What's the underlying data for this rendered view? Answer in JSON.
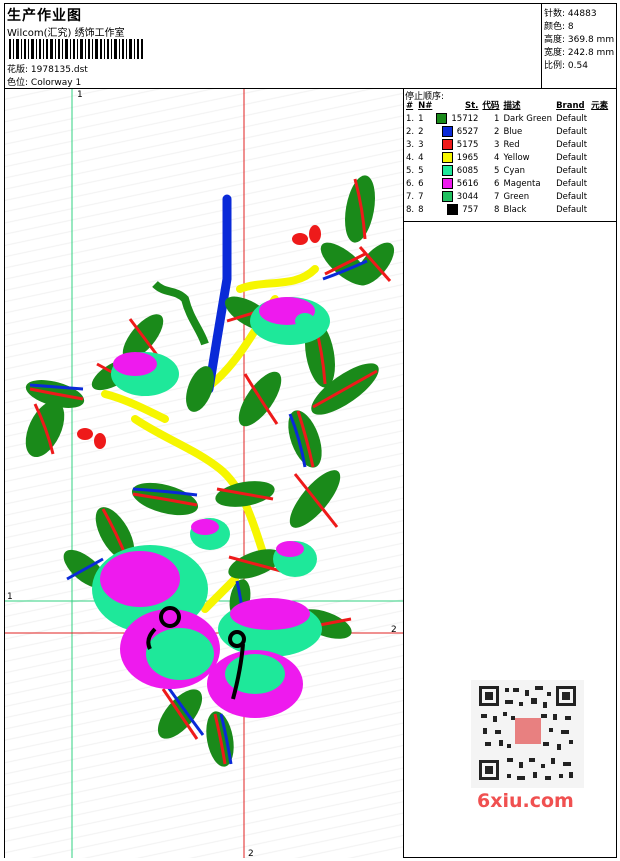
{
  "header": {
    "title": "生产作业图",
    "company": "Wilcom(汇究) 绣饰工作室",
    "pattern_label": "花版:",
    "pattern_value": "1978135.dst",
    "colorway_label": "色位:",
    "colorway_value": "Colorway 1"
  },
  "stats": {
    "stitches_label": "针数:",
    "stitches_value": "44883",
    "colors_label": "颜色:",
    "colors_value": "8",
    "height_label": "高度:",
    "height_value": "369.8 mm",
    "width_label": "宽度:",
    "width_value": "242.8 mm",
    "scale_label": "比例:",
    "scale_value": "0.54"
  },
  "stop_sequence": {
    "title": "停止顺序:",
    "columns": [
      "#",
      "N#",
      "St.",
      "代码",
      "描述",
      "Brand",
      "元素"
    ],
    "rows": [
      {
        "idx": "1.",
        "n": "1",
        "color": "#1a8a1a",
        "st": "15712",
        "code": "1",
        "desc": "Dark Green",
        "brand": "Default"
      },
      {
        "idx": "2.",
        "n": "2",
        "color": "#0a2ad8",
        "st": "6527",
        "code": "2",
        "desc": "Blue",
        "brand": "Default"
      },
      {
        "idx": "3.",
        "n": "3",
        "color": "#ee1a1a",
        "st": "5175",
        "code": "3",
        "desc": "Red",
        "brand": "Default"
      },
      {
        "idx": "4.",
        "n": "4",
        "color": "#f6f600",
        "st": "1965",
        "code": "4",
        "desc": "Yellow",
        "brand": "Default"
      },
      {
        "idx": "5.",
        "n": "5",
        "color": "#1ee89a",
        "st": "6085",
        "code": "5",
        "desc": "Cyan",
        "brand": "Default"
      },
      {
        "idx": "6.",
        "n": "6",
        "color": "#ee1aee",
        "st": "5616",
        "code": "6",
        "desc": "Magenta",
        "brand": "Default"
      },
      {
        "idx": "7.",
        "n": "7",
        "color": "#20c060",
        "st": "3044",
        "code": "7",
        "desc": "Green",
        "brand": "Default"
      },
      {
        "idx": "8.",
        "n": "8",
        "color": "#000000",
        "st": "757",
        "code": "8",
        "desc": "Black",
        "brand": "Default"
      }
    ]
  },
  "guides": {
    "top_marker": "1",
    "left_marker": "1",
    "right_marker": "2",
    "bottom_marker": "2"
  },
  "watermark": "6xiu.com",
  "colors": {
    "dark_green": "#1a8a1a",
    "blue": "#0a2ad8",
    "red": "#ee1a1a",
    "yellow": "#f6f600",
    "cyan": "#1ee89a",
    "magenta": "#ee1aee",
    "green": "#20c060",
    "black": "#000000"
  }
}
